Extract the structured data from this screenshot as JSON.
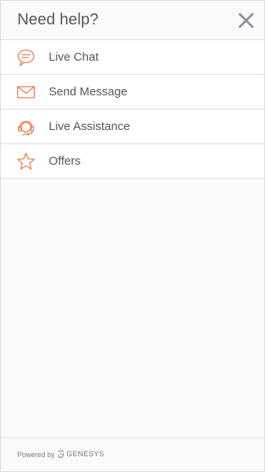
{
  "header": {
    "title": "Need help?"
  },
  "icons": {
    "close": "close-icon",
    "accent_color": "#ef7a52",
    "close_color": "#8c939d"
  },
  "menu": {
    "items": [
      {
        "label": "Live Chat",
        "icon": "chat-bubble-icon"
      },
      {
        "label": "Send Message",
        "icon": "envelope-icon"
      },
      {
        "label": "Live Assistance",
        "icon": "headset-icon"
      },
      {
        "label": "Offers",
        "icon": "star-icon"
      }
    ]
  },
  "footer": {
    "powered_by": "Powered by",
    "brand": "GENESYS"
  }
}
